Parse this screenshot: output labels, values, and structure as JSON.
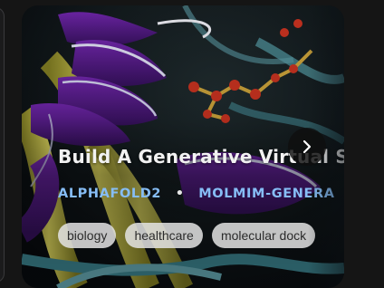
{
  "card": {
    "title": "Build A Generative Virtual S",
    "models": [
      "ALPHAFOLD2",
      "MOLMIM-GENERA"
    ],
    "separator": "•",
    "chips": [
      "biology",
      "healthcare",
      "molecular dock"
    ]
  },
  "icons": {
    "next": "chevron-right-icon"
  },
  "colors": {
    "background": "#151515",
    "model_text": "#86bdf5",
    "chip_bg": "#e4e4e4",
    "helix_purple": "#5b1a8e",
    "helix_yellow": "#c7c04a"
  }
}
